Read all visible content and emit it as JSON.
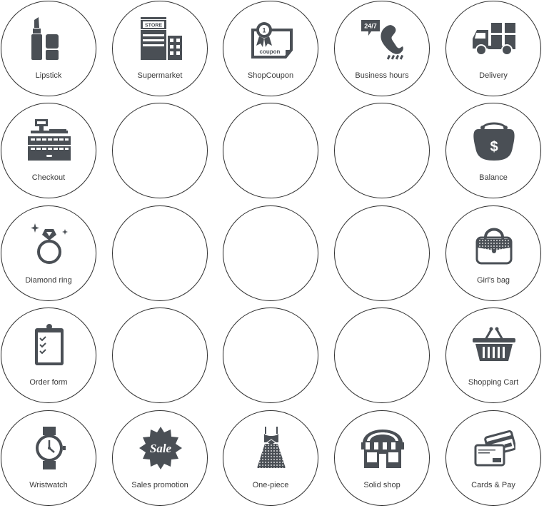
{
  "colors": {
    "icon": "#4a4f55",
    "border": "#333333",
    "text": "#3a3a3a"
  },
  "cells": [
    {
      "label": "Lipstick",
      "icon": "lipstick-icon"
    },
    {
      "label": "Supermarket",
      "icon": "store-icon",
      "icon_text": "STORE"
    },
    {
      "label": "ShopCoupon",
      "icon": "coupon-icon",
      "icon_text": "coupon",
      "badge": "1"
    },
    {
      "label": "Business hours",
      "icon": "phone-24-7-icon",
      "icon_text": "24/7"
    },
    {
      "label": "Delivery",
      "icon": "delivery-truck-icon"
    },
    {
      "label": "Checkout",
      "icon": "cash-register-icon"
    },
    {
      "label": "",
      "icon": ""
    },
    {
      "label": "",
      "icon": ""
    },
    {
      "label": "",
      "icon": ""
    },
    {
      "label": "Balance",
      "icon": "money-purse-icon",
      "icon_text": "$"
    },
    {
      "label": "Diamond ring",
      "icon": "diamond-ring-icon"
    },
    {
      "label": "",
      "icon": ""
    },
    {
      "label": "",
      "icon": ""
    },
    {
      "label": "",
      "icon": ""
    },
    {
      "label": "Girl's bag",
      "icon": "handbag-icon"
    },
    {
      "label": "Order form",
      "icon": "clipboard-icon"
    },
    {
      "label": "",
      "icon": ""
    },
    {
      "label": "",
      "icon": ""
    },
    {
      "label": "",
      "icon": ""
    },
    {
      "label": "Shopping Cart",
      "icon": "shopping-basket-icon"
    },
    {
      "label": "Wristwatch",
      "icon": "wristwatch-icon"
    },
    {
      "label": "Sales promotion",
      "icon": "sale-badge-icon",
      "icon_text": "Sale"
    },
    {
      "label": "One-piece",
      "icon": "dress-icon"
    },
    {
      "label": "Solid shop",
      "icon": "storefront-icon"
    },
    {
      "label": "Cards & Pay",
      "icon": "credit-cards-icon"
    }
  ]
}
